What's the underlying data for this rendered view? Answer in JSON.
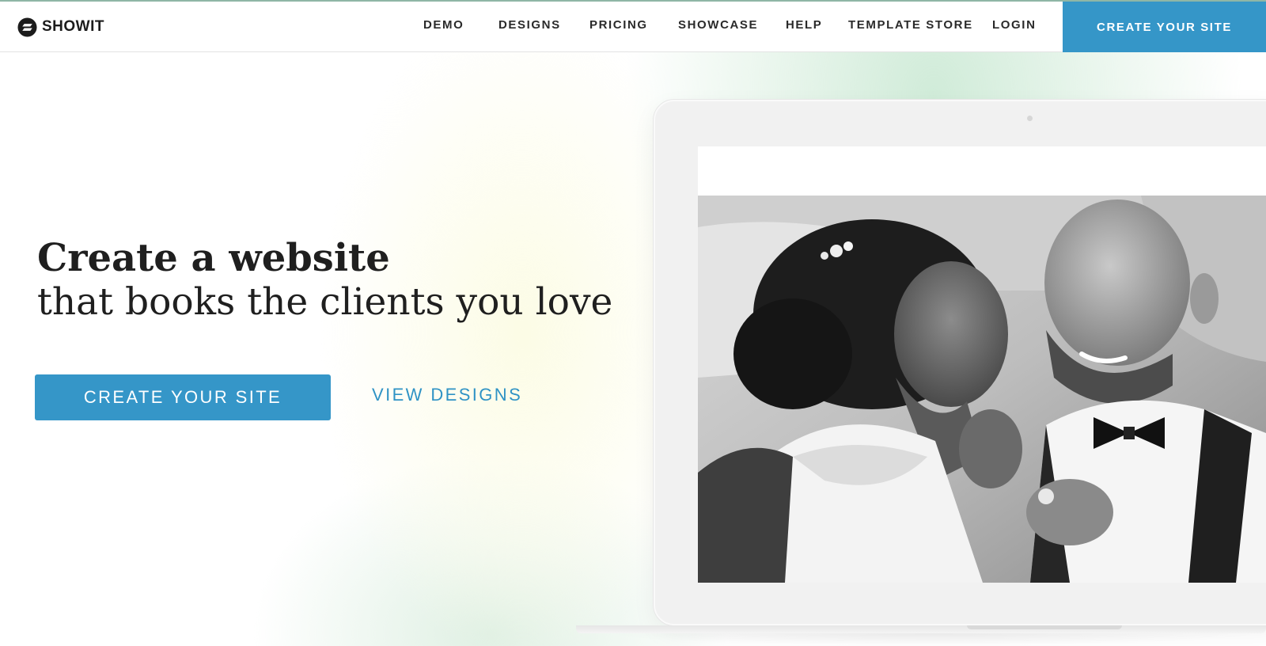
{
  "brand": {
    "name": "SHOWIT",
    "logo_icon": "showit-logo-icon"
  },
  "nav": {
    "items": [
      {
        "label": "DEMO"
      },
      {
        "label": "DESIGNS"
      },
      {
        "label": "PRICING"
      },
      {
        "label": "SHOWCASE"
      },
      {
        "label": "HELP"
      },
      {
        "label": "TEMPLATE STORE"
      },
      {
        "label": "LOGIN"
      }
    ],
    "cta_label": "CREATE YOUR SITE"
  },
  "hero": {
    "title": "Create a website",
    "subtitle": "that books the clients you love",
    "primary_button": "CREATE YOUR SITE",
    "secondary_button": "VIEW DESIGNS"
  },
  "colors": {
    "accent": "#3596c8",
    "link": "#2f93c5",
    "text": "#1f1f1f",
    "laptop_frame": "#f1f1f1"
  }
}
